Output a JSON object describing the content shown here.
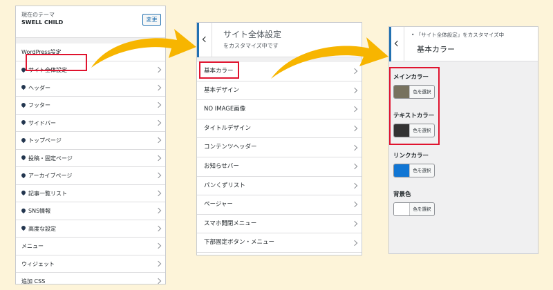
{
  "panel1": {
    "theme_label": "現在のテーマ",
    "theme_name": "SWELL CHILD",
    "change_button": "変更",
    "section_title": "WordPress設定",
    "swell_items": [
      {
        "label": "サイト全体設定",
        "icon": "swell-drop-icon"
      },
      {
        "label": "ヘッダー",
        "icon": "swell-drop-icon"
      },
      {
        "label": "フッター",
        "icon": "swell-drop-icon"
      },
      {
        "label": "サイドバー",
        "icon": "swell-drop-icon"
      },
      {
        "label": "トップページ",
        "icon": "swell-drop-icon"
      },
      {
        "label": "投稿・固定ページ",
        "icon": "swell-drop-icon"
      },
      {
        "label": "アーカイブページ",
        "icon": "swell-drop-icon"
      },
      {
        "label": "記事一覧リスト",
        "icon": "swell-drop-icon"
      },
      {
        "label": "SNS情報",
        "icon": "swell-drop-icon"
      },
      {
        "label": "高度な設定",
        "icon": "swell-drop-icon"
      }
    ],
    "plain_items": [
      {
        "label": "メニュー"
      },
      {
        "label": "ウィジェット"
      },
      {
        "label": "追加 CSS"
      }
    ]
  },
  "panel2": {
    "title": "サイト全体設定",
    "subtitle": "をカスタマイズ中です",
    "items": [
      {
        "label": "基本カラー"
      },
      {
        "label": "基本デザイン"
      },
      {
        "label": "NO IMAGE画像"
      },
      {
        "label": "タイトルデザイン"
      },
      {
        "label": "コンテンツヘッダー"
      },
      {
        "label": "お知らせバー"
      },
      {
        "label": "パンくずリスト"
      },
      {
        "label": "ページャー"
      },
      {
        "label": "スマホ開閉メニュー"
      },
      {
        "label": "下部固定ボタン・メニュー"
      }
    ]
  },
  "panel3": {
    "breadcrumb": "• 「サイト全体設定」をカスタマイズ中",
    "title": "基本カラー",
    "colors": [
      {
        "label": "メインカラー",
        "button": "色を選択",
        "swatch": "#77725f"
      },
      {
        "label": "テキストカラー",
        "button": "色を選択",
        "swatch": "#333333"
      },
      {
        "label": "リンクカラー",
        "button": "色を選択",
        "swatch": "#1176d4"
      },
      {
        "label": "背景色",
        "button": "色を選択",
        "swatch": "#ffffff"
      }
    ]
  },
  "colors": {
    "background": "#fdf4d9",
    "highlight": "#e0132e",
    "arrow": "#f7b500",
    "accent": "#2271b1"
  }
}
